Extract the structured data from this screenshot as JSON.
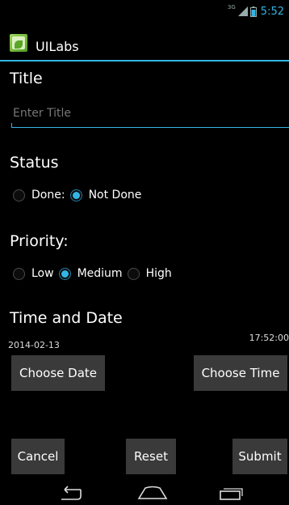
{
  "status_bar": {
    "network": "3G",
    "time": "5:52"
  },
  "action_bar": {
    "title": "UILabs"
  },
  "title_section": {
    "label": "Title",
    "placeholder": "Enter Title",
    "value": ""
  },
  "status_section": {
    "label": "Status",
    "options": [
      {
        "label": "Done:",
        "selected": false
      },
      {
        "label": "Not Done",
        "selected": true
      }
    ]
  },
  "priority_section": {
    "label": "Priority:",
    "options": [
      {
        "label": "Low",
        "selected": false
      },
      {
        "label": "Medium",
        "selected": true
      },
      {
        "label": "High",
        "selected": false
      }
    ]
  },
  "time_date_section": {
    "label": "Time and Date",
    "date": "2014-02-13",
    "time": "17:52:00",
    "choose_date_label": "Choose Date",
    "choose_time_label": "Choose Time"
  },
  "footer_buttons": {
    "cancel": "Cancel",
    "reset": "Reset",
    "submit": "Submit"
  },
  "nav_bar": {
    "icons": [
      "back-icon",
      "home-icon",
      "recents-icon"
    ]
  },
  "colors": {
    "accent": "#33b5e5",
    "button_bg": "#3a3a3a",
    "background": "#000000"
  }
}
